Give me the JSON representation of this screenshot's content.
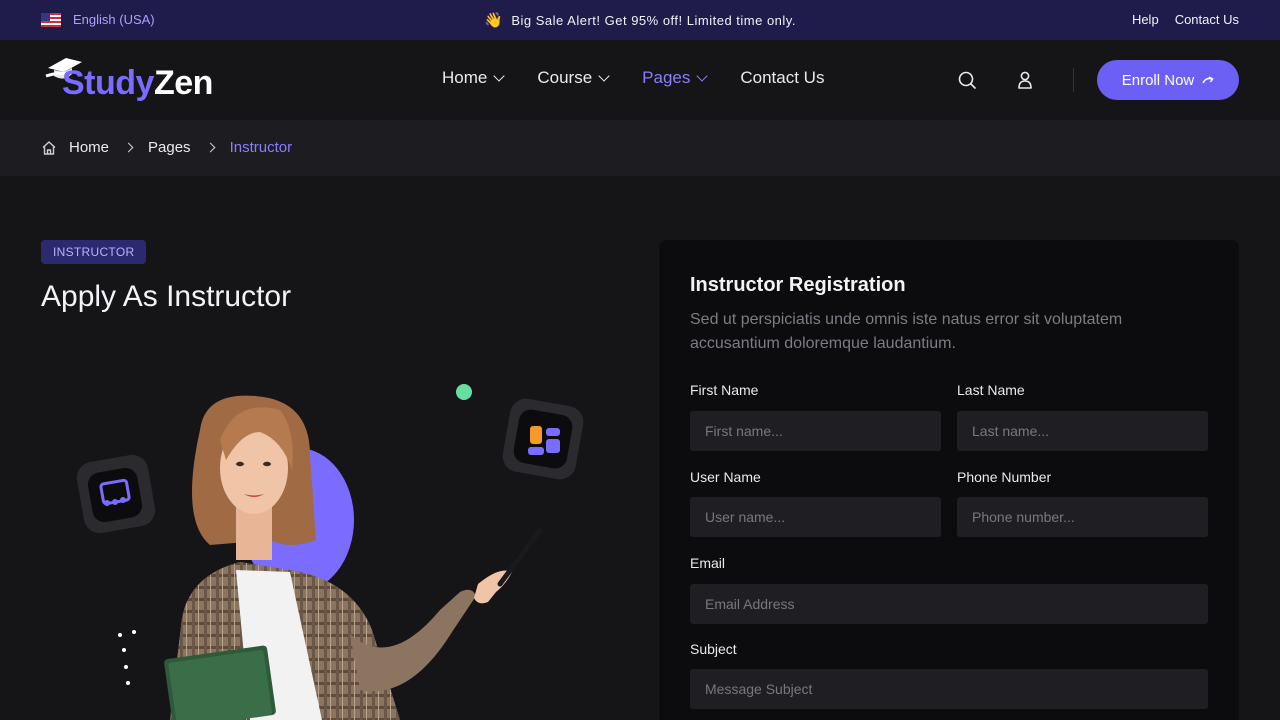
{
  "topbar": {
    "language": "English (USA)",
    "promo_icon": "👋",
    "promo": "Big Sale Alert! Get 95% off! Limited time only.",
    "links": [
      "Help",
      "Contact Us"
    ]
  },
  "brand": {
    "name_a": "Study",
    "name_b": "Zen"
  },
  "nav": [
    {
      "label": "Home",
      "dropdown": true,
      "active": false
    },
    {
      "label": "Course",
      "dropdown": true,
      "active": false
    },
    {
      "label": "Pages",
      "dropdown": true,
      "active": true
    },
    {
      "label": "Contact Us",
      "dropdown": false,
      "active": false
    }
  ],
  "header": {
    "cta_label": "Enroll Now"
  },
  "breadcrumb": {
    "items": [
      "Home",
      "Pages"
    ],
    "current": "Instructor"
  },
  "hero": {
    "badge": "INSTRUCTOR",
    "title": "Apply As Instructor"
  },
  "form": {
    "title": "Instructor Registration",
    "description": "Sed ut perspiciatis unde omnis iste natus error sit voluptatem accusantium doloremque laudantium.",
    "first_name": {
      "label": "First Name",
      "placeholder": "First name..."
    },
    "last_name": {
      "label": "Last Name",
      "placeholder": "Last name..."
    },
    "user_name": {
      "label": "User Name",
      "placeholder": "User name..."
    },
    "phone": {
      "label": "Phone Number",
      "placeholder": "Phone number..."
    },
    "email": {
      "label": "Email",
      "placeholder": "Email Address"
    },
    "subject": {
      "label": "Subject",
      "placeholder": "Message Subject"
    }
  },
  "colors": {
    "accent": "#6c5ff3",
    "topbar": "#1f1b4a",
    "background": "#151518",
    "panel": "#0c0c0e",
    "field": "#1f1f23",
    "dot": "#66e0a0"
  }
}
